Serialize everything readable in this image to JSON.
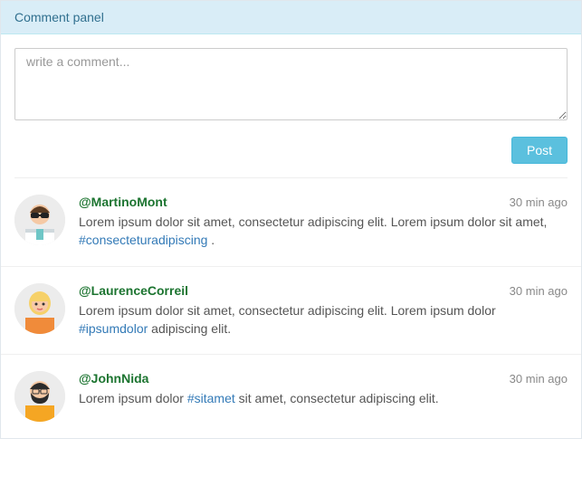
{
  "panel": {
    "title": "Comment panel"
  },
  "composer": {
    "placeholder": "write a comment...",
    "value": "",
    "post_label": "Post"
  },
  "comments": [
    {
      "username": "@MartinoMont",
      "time": "30 min ago",
      "text_before": "Lorem ipsum dolor sit amet, consectetur adipiscing elit. Lorem ipsum dolor sit amet, ",
      "hashtag": "#consecteturadipiscing",
      "text_after": " .",
      "avatar": "male-sunglasses"
    },
    {
      "username": "@LaurenceCorreil",
      "time": "30 min ago",
      "text_before": "Lorem ipsum dolor sit amet, consectetur adipiscing elit. Lorem ipsum dolor ",
      "hashtag": "#ipsumdolor",
      "text_after": " adipiscing elit.",
      "avatar": "female-blonde"
    },
    {
      "username": "@JohnNida",
      "time": "30 min ago",
      "text_before": "Lorem ipsum dolor ",
      "hashtag": "#sitamet",
      "text_after": " sit amet, consectetur adipiscing elit.",
      "avatar": "male-beard"
    }
  ],
  "avatar_svgs": {
    "male-sunglasses": "<svg class='av-svg' viewBox='0 0 56 56'><circle cx='28' cy='28' r='28' fill='#ececec'/><rect x='12' y='38' width='32' height='20' fill='#ffffff'/><rect x='12' y='38' width='32' height='4' fill='#cfd8dc'/><rect x='24' y='38' width='8' height='12' fill='#6ec6c6'/><circle cx='28' cy='22' r='11' fill='#f5c9a5'/><path d='M17 20 q11 -14 22 0' fill='#5a3b22'/><rect x='18' y='20' width='9' height='6' rx='2' fill='#222'/><rect x='29' y='20' width='9' height='6' rx='2' fill='#222'/><rect x='27' y='22' width='2' height='2' fill='#222'/></svg>",
    "female-blonde": "<svg class='av-svg' viewBox='0 0 56 56'><circle cx='28' cy='28' r='28' fill='#ececec'/><rect x='12' y='38' width='32' height='20' fill='#f08b3a'/><ellipse cx='28' cy='22' rx='12' ry='13' fill='#f6d169'/><circle cx='28' cy='23' r='9' fill='#f7c9a8'/><rect x='19' y='14' width='18' height='6' fill='#f6d169'/><circle cx='24' cy='23' r='1.5' fill='#333'/><circle cx='32' cy='23' r='1.5' fill='#333'/><path d='M25 28 q3 2 6 0' stroke='#d66' stroke-width='1.5' fill='none'/></svg>",
    "male-beard": "<svg class='av-svg' viewBox='0 0 56 56'><circle cx='28' cy='28' r='28' fill='#ececec'/><rect x='12' y='38' width='32' height='20' fill='#f5a623'/><circle cx='28' cy='22' r='11' fill='#f5c9a5'/><path d='M17 20 q11 -14 22 0' fill='#2b2b2b'/><path d='M18 24 q0 12 10 12 q10 0 10 -12 q-4 6 -10 6 q-6 0 -10 -6 z' fill='#2b2b2b'/><rect x='20' y='20' width='7' height='5' rx='1' fill='none' stroke='#333'/><rect x='29' y='20' width='7' height='5' rx='1' fill='none' stroke='#333'/><line x1='27' y1='22' x2='29' y2='22' stroke='#333'/></svg>"
  }
}
